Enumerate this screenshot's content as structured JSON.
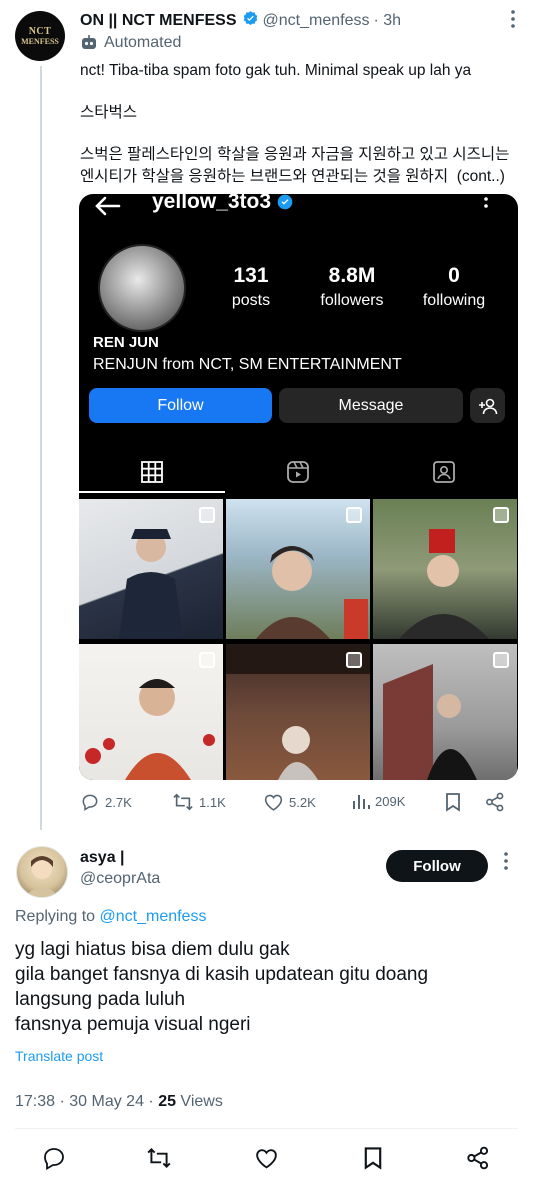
{
  "tweet": {
    "display_name": "ON || NCT MENFESS",
    "handle": "@nct_menfess",
    "time": "· 3h",
    "automated_label": "Automated",
    "avatar_text": [
      "NCT",
      "MENFESS"
    ],
    "paragraphs": [
      "nct! Tiba-tiba spam foto gak tuh. Minimal speak up lah ya",
      "스타벅스",
      "스벅은 팔레스타인의 학살을 응원과 자금을 지원하고 있고 시즈니는 엔시티가 학살을 응원하는 브랜드와 연관되는 것을 원하지  (cont..)"
    ],
    "actions": {
      "replies": "2.7K",
      "retweets": "1.1K",
      "likes": "5.2K",
      "views": "209K"
    }
  },
  "instagram": {
    "username": "yellow_3to3",
    "posts_count": "131",
    "posts_label": "posts",
    "followers_count": "8.8M",
    "followers_label": "followers",
    "following_count": "0",
    "following_label": "following",
    "display_name": "REN JUN",
    "bio": "RENJUN from NCT, SM ENTERTAINMENT",
    "follow_label": "Follow",
    "message_label": "Message"
  },
  "reply": {
    "display_name": "asya |",
    "handle": "@ceoprAta",
    "follow_label": "Follow",
    "replying_prefix": "Replying to ",
    "replying_to": "@nct_menfess",
    "lines": [
      "yg lagi hiatus bisa diem dulu gak",
      "gila banget fansnya di kasih updatean gitu doang",
      "langsung pada luluh",
      "fansnya pemuja visual ngeri"
    ],
    "translate": "Translate post",
    "timestamp": "17:38 · 30 May 24 · ",
    "views_count": "25",
    "views_label": " Views"
  },
  "colors": {
    "accent": "#1d9bf0",
    "text": "#0f1419",
    "muted": "#536471",
    "ig_follow": "#1877f2"
  }
}
